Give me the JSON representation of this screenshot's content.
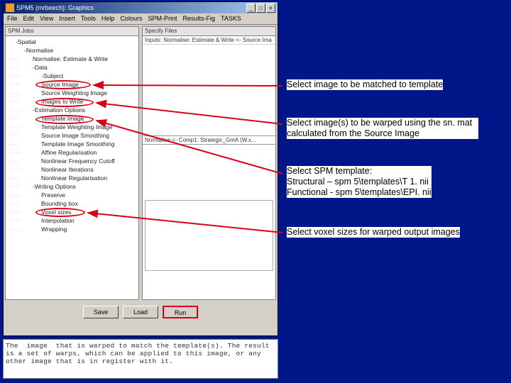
{
  "window": {
    "title": "SPM5 (mrbeech): Graphics",
    "min": "_",
    "max": "□",
    "close": "×"
  },
  "menubar": [
    "File",
    "Edit",
    "View",
    "Insert",
    "Tools",
    "Help",
    "Colours",
    "SPM-Print",
    "Results-Fig",
    "TASKS"
  ],
  "left_pane_header": "SPM Jobs",
  "right_pane_header": "Specify Files",
  "right_values_header": "Inputs: Normalise: Estimate & Write <- Source Ima",
  "right_sub_header": "Normalise <- Comp1: Strategic_GmA (W.x...",
  "tree": [
    {
      "d": 1,
      "t": "-Spatial"
    },
    {
      "d": 2,
      "t": "-Normalise"
    },
    {
      "d": 3,
      "t": "Normalise: Estimate & Write"
    },
    {
      "d": 3,
      "t": "-Data"
    },
    {
      "d": 4,
      "t": "-Subject"
    },
    {
      "d": 4,
      "t": "Source Image",
      "circ": 1
    },
    {
      "d": 4,
      "t": "Source Weighting Image"
    },
    {
      "d": 4,
      "t": "Images to Write",
      "circ": 2
    },
    {
      "d": 3,
      "t": "-Estimation Options"
    },
    {
      "d": 4,
      "t": "Template Image",
      "circ": 3
    },
    {
      "d": 4,
      "t": "Template Weighting Image"
    },
    {
      "d": 4,
      "t": "Source Image Smoothing"
    },
    {
      "d": 4,
      "t": "Template Image Smoothing"
    },
    {
      "d": 4,
      "t": "Affine Regularisation"
    },
    {
      "d": 4,
      "t": "Nonlinear Frequency Cutoff"
    },
    {
      "d": 4,
      "t": "Nonlinear Iterations"
    },
    {
      "d": 4,
      "t": "Nonlinear Regularisation"
    },
    {
      "d": 3,
      "t": "-Writing Options"
    },
    {
      "d": 4,
      "t": "Preserve"
    },
    {
      "d": 4,
      "t": "Bounding box"
    },
    {
      "d": 4,
      "t": "Voxel sizes",
      "circ": 4
    },
    {
      "d": 4,
      "t": "Interpolation"
    },
    {
      "d": 4,
      "t": "Wrapping"
    }
  ],
  "buttons": {
    "save": "Save",
    "load": "Load",
    "run": "Run"
  },
  "helptext": "The  image  that is warped to match the template(s). The result\nis a set of warps, which can be applied to this image, or any\nother image that is in register with it.",
  "annotations": {
    "a1": "Select image to be matched to template",
    "a2": "Select image(s) to be warped using the sn. mat calculated from the Source Image",
    "a3_l1": "Select SPM template:",
    "a3_l2": "Structural – spm 5\\templates\\T 1. nii",
    "a3_l3": "Functional - spm 5\\templates\\EPI. nii",
    "a4": "Select voxel sizes for warped output images"
  }
}
